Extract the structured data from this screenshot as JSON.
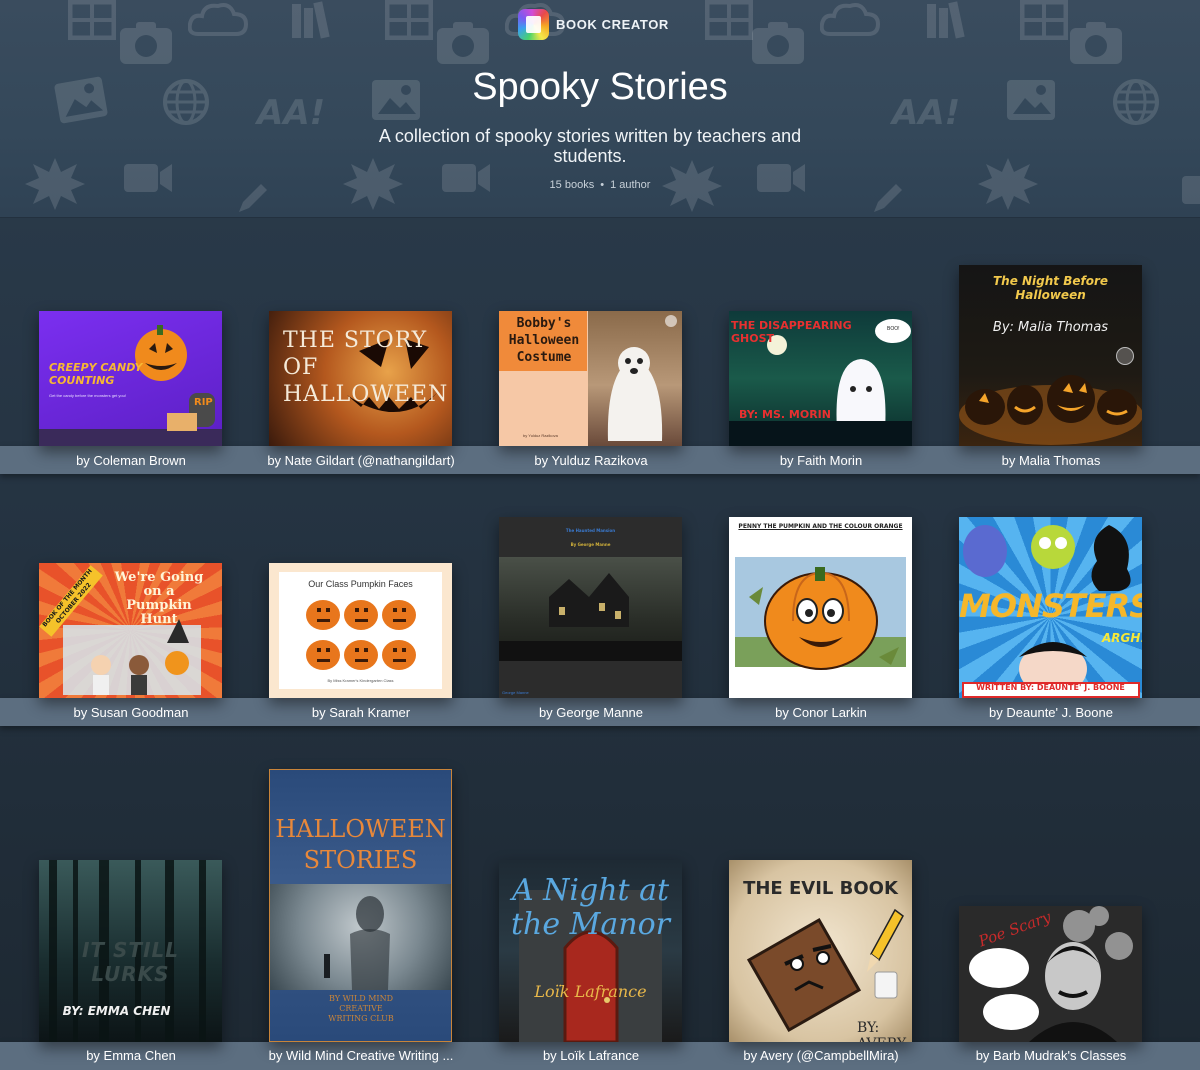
{
  "brand": {
    "name": "BOOK CREATOR",
    "logo_icon": "book-creator-logo-icon"
  },
  "header": {
    "title": "Spooky Stories",
    "subtitle": "A collection of spooky stories written by teachers and students.",
    "books_count": "15 books",
    "separator": "•",
    "authors_count": "1 author"
  },
  "books": [
    {
      "author": "by Coleman Brown",
      "cover_title": "CREEPY CANDY COUNTING",
      "cover_sub": "Get the candy before the monsters get you!",
      "cover_badge": "RIP"
    },
    {
      "author": "by Nate Gildart (@nathangildart)",
      "cover_title": "THE STORY OF HALLOWEEN"
    },
    {
      "author": "by Yulduz Razikova",
      "cover_title": "Bobby's Halloween Costume",
      "cover_sub": "by Yulduz Razikova"
    },
    {
      "author": "by Faith Morin",
      "cover_title": "THE DISAPPEARING GHOST",
      "cover_sub": "BY: MS. MORIN",
      "cover_badge": "BOO!"
    },
    {
      "author": "by Malia Thomas",
      "cover_title": "The Night Before Halloween",
      "cover_sub": "By: Malia Thomas"
    },
    {
      "author": "by Susan Goodman",
      "cover_title": "We're Going on a Pumpkin Hunt",
      "cover_badge": "BOOK OF THE MONTH OCTOBER 2022"
    },
    {
      "author": "by Sarah Kramer",
      "cover_title": "Our Class Pumpkin Faces",
      "cover_sub": "By Miss Kramer's Kindergarten Class"
    },
    {
      "author": "by George Manne",
      "cover_title": "The Haunted Mansion",
      "cover_sub": "By George Manne",
      "cover_badge": "George Manne"
    },
    {
      "author": "by Conor Larkin",
      "cover_title": "PENNY THE PUMPKIN AND THE COLOUR ORANGE"
    },
    {
      "author": "by Deaunte' J. Boone",
      "cover_title": "MONSTERS",
      "cover_sub": "WRITTEN BY: DEAUNTE' J. BOONE",
      "cover_badge": "ARGH!"
    },
    {
      "author": "by Emma Chen",
      "cover_title": "IT STILL LURKS",
      "cover_sub": "BY: EMMA CHEN"
    },
    {
      "author": "by Wild Mind Creative Writing ...",
      "cover_title": "HALLOWEEN STORIES",
      "cover_sub": "BY WILD MIND CREATIVE WRITING CLUB"
    },
    {
      "author": "by Loïk Lafrance",
      "cover_title": "A Night at the Manor",
      "cover_sub": "Loïk Lafrance"
    },
    {
      "author": "by Avery (@CampbellMira)",
      "cover_title": "THE EVIL BOOK",
      "cover_sub": "BY: AVERY"
    },
    {
      "author": "by Barb Mudrak's Classes",
      "cover_title": "Poe Scary"
    }
  ],
  "colors": {
    "header_bg": "#34485a",
    "shelf": "#5c6e80",
    "page_bg": "#263544"
  }
}
